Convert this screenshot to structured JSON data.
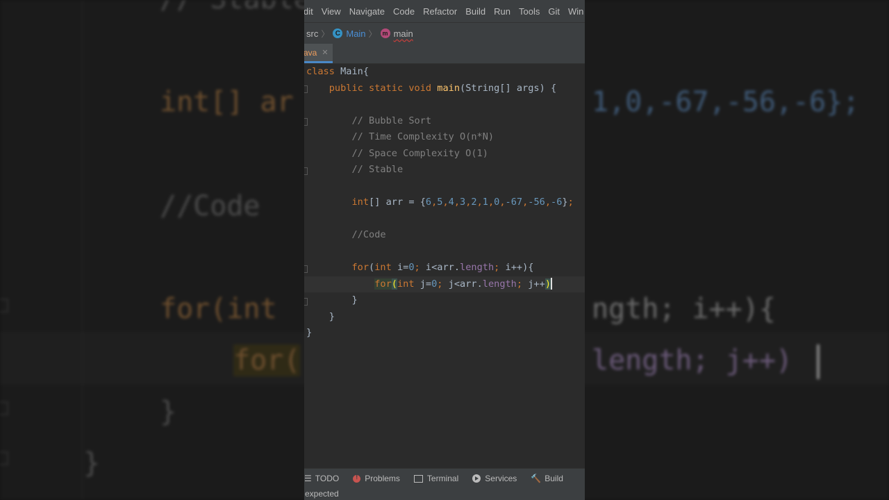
{
  "menu": {
    "items": [
      "dit",
      "View",
      "Navigate",
      "Code",
      "Refactor",
      "Build",
      "Run",
      "Tools",
      "Git",
      "Win"
    ]
  },
  "breadcrumb": {
    "src": "src",
    "class_name": "Main",
    "method_name": "main",
    "class_icon_letter": "C",
    "method_icon_letter": "m"
  },
  "tab": {
    "label": "ava",
    "close": "✕"
  },
  "editor": {
    "lines": [
      "class Main{",
      "    public static void main(String[] args) {",
      "",
      "        // Bubble Sort",
      "        // Time Complexity O(n*N)",
      "        // Space Complexity O(1)",
      "        // Stable",
      "",
      "        int[] arr = {6,5,4,3,2,1,0,-67,-56,-6};",
      "",
      "        //Code",
      "",
      "        for(int i=0; i<arr.length; i++){",
      "            for(int j=0; j<arr.length; j++)",
      "        }",
      "    }",
      "}"
    ]
  },
  "background_zoom": {
    "line1": "// Stable",
    "line2_left": "int[] ar",
    "line2_right": "1,0,-67,-56,-6};",
    "line3": "//Code",
    "line4_left": "for(int",
    "line4_right": "ngth; i++){",
    "line5_left": "for(",
    "line5_right": "length; j++)",
    "line6": "}",
    "line7": "}"
  },
  "toolwindows": {
    "todo": "TODO",
    "problems": "Problems",
    "terminal": "Terminal",
    "services": "Services",
    "build": "Build"
  },
  "status": {
    "message": "expected"
  },
  "colors": {
    "keyword": "#cc7832",
    "function": "#ffc66d",
    "number": "#6897bb",
    "field": "#9876aa",
    "comment": "#808080",
    "plain": "#a9b7c6"
  }
}
